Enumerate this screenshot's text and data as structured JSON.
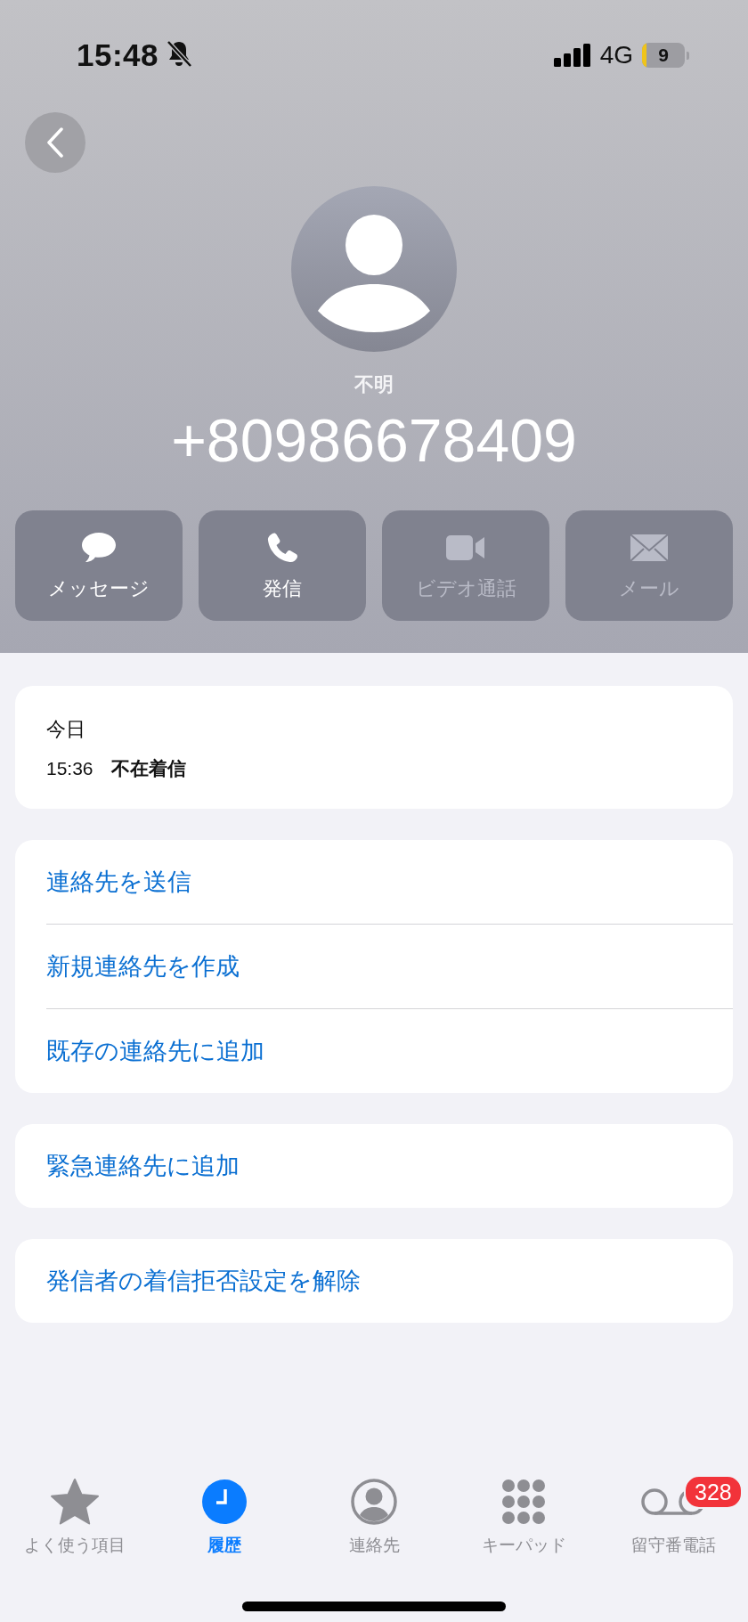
{
  "status_bar": {
    "time": "15:48",
    "silent": true,
    "network": "4G",
    "battery": "9"
  },
  "contact": {
    "label": "不明",
    "number": "+80986678409"
  },
  "actions": [
    {
      "kind": "message",
      "label": "メッセージ",
      "disabled": false
    },
    {
      "kind": "call",
      "label": "発信",
      "disabled": false
    },
    {
      "kind": "video",
      "label": "ビデオ通話",
      "disabled": true
    },
    {
      "kind": "mail",
      "label": "メール",
      "disabled": true
    }
  ],
  "history": {
    "day": "今日",
    "time": "15:36",
    "type": "不在着信"
  },
  "option_groups": [
    [
      "連絡先を送信",
      "新規連絡先を作成",
      "既存の連絡先に追加"
    ],
    [
      "緊急連絡先に追加"
    ],
    [
      "発信者の着信拒否設定を解除"
    ]
  ],
  "tabs": [
    {
      "kind": "favorites",
      "label": "よく使う項目",
      "selected": false
    },
    {
      "kind": "recents",
      "label": "履歴",
      "selected": true
    },
    {
      "kind": "contacts",
      "label": "連絡先",
      "selected": false
    },
    {
      "kind": "keypad",
      "label": "キーパッド",
      "selected": false
    },
    {
      "kind": "voicemail",
      "label": "留守番電話",
      "selected": false,
      "badge": "328"
    }
  ]
}
